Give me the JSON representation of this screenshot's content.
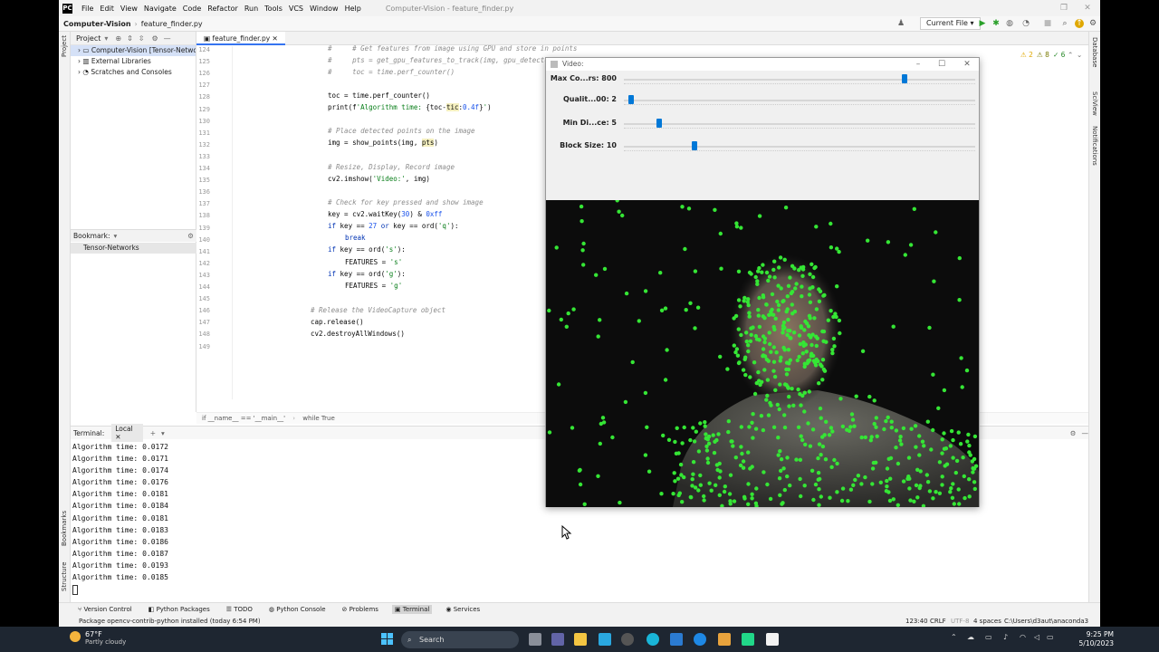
{
  "window": {
    "title": "Computer-Vision - feature_finder.py",
    "menu": [
      "File",
      "Edit",
      "View",
      "Navigate",
      "Code",
      "Refactor",
      "Run",
      "Tools",
      "VCS",
      "Window",
      "Help"
    ]
  },
  "navbar": {
    "project": "Computer-Vision",
    "file": "feature_finder.py",
    "run_config": "Current File"
  },
  "project_panel": {
    "title": "Project",
    "items": [
      {
        "label": "Computer-Vision [Tensor-Networks]",
        "selected": true
      },
      {
        "label": "External Libraries",
        "selected": false
      },
      {
        "label": "Scratches and Consoles",
        "selected": false
      }
    ],
    "bookmarks_title": "Bookmark:",
    "bookmark_item": "Tensor-Networks"
  },
  "editor": {
    "tab": "feature_finder.py",
    "inspection": {
      "warnings": "2",
      "weak": "8",
      "typos": "6"
    },
    "line_numbers": [
      "124",
      "125",
      "126",
      "127",
      "128",
      "129",
      "130",
      "131",
      "132",
      "133",
      "134",
      "135",
      "136",
      "137",
      "138",
      "139",
      "140",
      "141",
      "142",
      "143",
      "144",
      "145",
      "146",
      "147",
      "148",
      "149"
    ],
    "breadcrumb": [
      "if __name__ == '__main__'",
      "while True"
    ]
  },
  "video_window": {
    "title": "Video:",
    "sliders": [
      {
        "label": "Max Co...rs: 800",
        "value": 800,
        "max": 1000
      },
      {
        "label": "Qualit...00: 2",
        "value": 2,
        "max": 100
      },
      {
        "label": "Min Di...ce: 5",
        "value": 5,
        "max": 50
      },
      {
        "label": "Block Size: 10",
        "value": 10,
        "max": 50
      }
    ]
  },
  "terminal": {
    "title": "Terminal:",
    "tab": "Local",
    "lines": [
      "Algorithm time: 0.0172",
      "Algorithm time: 0.0171",
      "Algorithm time: 0.0174",
      "Algorithm time: 0.0176",
      "Algorithm time: 0.0181",
      "Algorithm time: 0.0184",
      "Algorithm time: 0.0181",
      "Algorithm time: 0.0183",
      "Algorithm time: 0.0186",
      "Algorithm time: 0.0187",
      "Algorithm time: 0.0193",
      "Algorithm time: 0.0185"
    ]
  },
  "tool_windows": [
    "Version Control",
    "Python Packages",
    "TODO",
    "Python Console",
    "Problems",
    "Terminal",
    "Services"
  ],
  "side_tools": {
    "left": [
      "Project",
      "Bookmarks",
      "Structure"
    ],
    "right": [
      "Database",
      "SciView",
      "Notifications"
    ]
  },
  "status_bar": {
    "message": "Package opencv-contrib-python installed (today 6:54 PM)",
    "position": "123:40",
    "line_sep": "CRLF",
    "encoding": "UTF-8",
    "indent": "4 spaces",
    "interpreter": "C:\\Users\\d3aut\\anaconda3"
  },
  "taskbar": {
    "weather_temp": "67°F",
    "weather_desc": "Partly cloudy",
    "search": "Search",
    "time": "9:25 PM",
    "date": "5/10/2023"
  },
  "colors": {
    "accent": "#3574f0",
    "slider": "#0078d7",
    "feature_point": "#35e635"
  }
}
